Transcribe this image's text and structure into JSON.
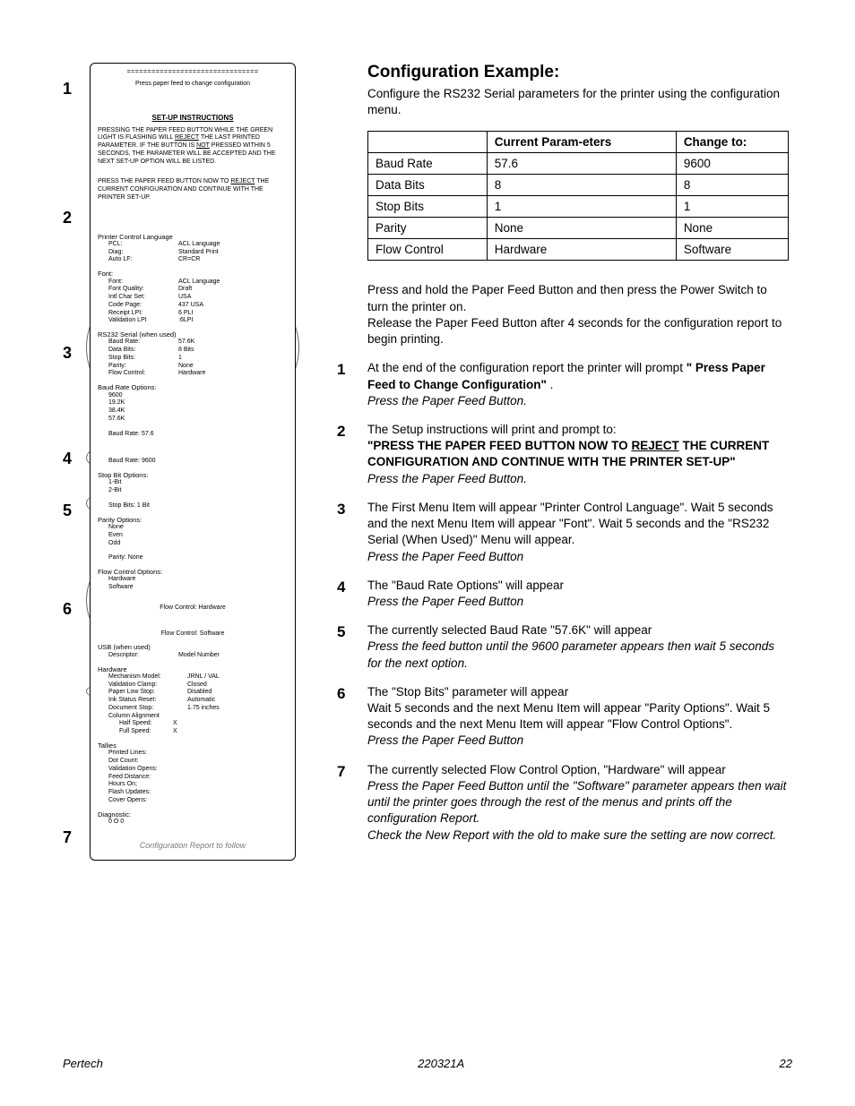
{
  "heading": "Configuration Example:",
  "intro": "Configure the RS232 Serial parameters for the printer using the configuration menu.",
  "table": {
    "head": [
      "",
      "Current Param-eters",
      "Change to:"
    ],
    "rows": [
      [
        "Baud Rate",
        "57.6",
        "9600"
      ],
      [
        "Data Bits",
        "8",
        "8"
      ],
      [
        "Stop Bits",
        "1",
        "1"
      ],
      [
        "Parity",
        "None",
        "None"
      ],
      [
        "Flow Control",
        "Hardware",
        "Software"
      ]
    ]
  },
  "pre_steps": [
    "Press and hold the Paper Feed Button and then press the Power Switch to turn the printer on.",
    "Release the Paper Feed Button after 4 seconds for the configuration report to begin printing."
  ],
  "steps": [
    {
      "n": "1",
      "body": "At the end of the configuration report the printer will prompt ",
      "bold": "\" Press Paper Feed to Change Configuration\"",
      "after_bold": " .",
      "em": "Press the Paper Feed Button."
    },
    {
      "n": "2",
      "body": "The Setup instructions will print and prompt to:",
      "bold": "\"PRESS THE PAPER FEED BUTTON NOW TO REJECT THE CURRENT CONFIGURATION AND CONTINUE WITH THE PRINTER SET-UP\"",
      "em": "Press the Paper Feed Button."
    },
    {
      "n": "3",
      "body": "The First Menu Item will appear \"Printer Control Language\". Wait 5 seconds and the next Menu Item will appear \"Font\". Wait 5 seconds and the \"RS232 Serial (When Used)\" Menu will appear.",
      "em": "Press the Paper Feed Button"
    },
    {
      "n": "4",
      "body": "The \"Baud Rate Options\" will appear",
      "em": "Press the Paper Feed Button"
    },
    {
      "n": "5",
      "body": "The currently selected Baud Rate \"57.6K\"  will appear",
      "em": "Press the feed button until the 9600 parameter appears then wait 5 seconds for the next option."
    },
    {
      "n": "6",
      "body": "The \"Stop Bits\" parameter will appear",
      "body2": "Wait 5 seconds and the next Menu Item will appear \"Parity Options\". Wait 5 seconds and the next Menu Item will appear \"Flow Control Options\".",
      "em": "Press the Paper Feed Button"
    },
    {
      "n": "7",
      "body": "The currently selected Flow Control Option, \"Hardware\"  will appear",
      "em": "Press the Paper Feed Button until the \"Software\" parameter appears then wait until the printer goes through the rest of the menus and prints off the configuration Report.",
      "em2": "Check the New Report with the old to make sure the setting are now correct."
    }
  ],
  "receipt": {
    "eq": "================================",
    "line1": "Press paper feed to change configuration",
    "setup_title": "SET-UP INSTRUCTIONS",
    "setup_body": "PRESSING THE PAPER FEED BUTTON WHILE THE GREEN LIGHT IS FLASHING WILL REJECT THE LAST PRINTED PARAMETER. IF THE BUTTON IS NOT PRESSED WITHIN 5 SECONDS, THE PARAMETER WILL BE ACCEPTED AND THE NEXT SET-UP OPTION WILL BE LISTED.",
    "reject_body": "PRESS THE PAPER FEED BUTTON NOW TO REJECT THE CURRENT CONFIGURATION AND CONTINUE WITH THE PRINTER SET-UP.",
    "pcl_header": "Printer Control Language",
    "pcl": [
      [
        "PCL:",
        "ACL Language"
      ],
      [
        "Diag:",
        "Standard Print"
      ],
      [
        "Auto LF:",
        "CR=CR"
      ]
    ],
    "font_header": "Font:",
    "font": [
      [
        "Font:",
        "ACL Language"
      ],
      [
        "Font Quality:",
        "Draft"
      ],
      [
        "Intl Char Set:",
        "USA"
      ],
      [
        "Code Page:",
        "437 USA"
      ],
      [
        "Receipt LPI:",
        "6 PLI"
      ],
      [
        "Validation LPI",
        ":6LPI"
      ]
    ],
    "rs_header": "RS232 Serial (when used)",
    "rs": [
      [
        "Baud Rate:",
        "57.6K"
      ],
      [
        "Data Bits:",
        "8 Bits"
      ],
      [
        "Stop Bits:",
        "1"
      ],
      [
        "Parity:",
        "None"
      ],
      [
        "Flow Control:",
        "Hardware"
      ]
    ],
    "baud_opt_header": "Baud Rate Options:",
    "baud_opts": [
      "9600",
      "19.2K",
      "38.4K",
      "57.6K"
    ],
    "baud_line_a": "Baud Rate:      57.6",
    "baud_line_b": "Baud Rate:      9600",
    "stop_opt_header": "Stop Bit Options:",
    "stop_opts": [
      "1-Bit",
      "2-Bit"
    ],
    "stop_line": "Stop Bits:         1 Bit",
    "parity_opt_header": "Parity Options:",
    "parity_opts": [
      "None",
      "Even",
      "Odd"
    ],
    "parity_line": "Parity:              None",
    "flow_opt_header": "Flow Control Options:",
    "flow_opts": [
      "Hardware",
      "Software"
    ],
    "flow_hw": "Flow Control: Hardware",
    "flow_sw": "Flow Control: Software",
    "usb_header": "USB (when used)",
    "usb": [
      [
        "Descriptor:",
        "Model Number"
      ]
    ],
    "hw_header": "Hardware",
    "hw": [
      [
        "Mechanism Model:",
        "JRNL / VAL"
      ],
      [
        "Validation Clamp:",
        "Closed"
      ],
      [
        "Paper Low Stop:",
        "Disabled"
      ],
      [
        "Ink Status Reset:",
        "Automatic"
      ],
      [
        "Document Stop:",
        "1.75 inches"
      ]
    ],
    "col_header": "Column Alignment",
    "col": [
      [
        "Half Speed:",
        "X"
      ],
      [
        "Full Speed:",
        "X"
      ]
    ],
    "tallies_header": "Tallies",
    "tallies": [
      "Printed Lines:",
      "Dot Count:",
      "Validation Opens:",
      "Feed Distance:",
      "Hours On;",
      "Flash Updates:",
      "Cover Opens:"
    ],
    "diag_header": "Diagnostic:",
    "diag_line": "0    O    0",
    "footer": "Configuration Report to follow"
  },
  "footer": {
    "left": "Pertech",
    "center": "220321A",
    "right": "22"
  },
  "nums": [
    "1",
    "2",
    "3",
    "4",
    "5",
    "6",
    "7"
  ]
}
